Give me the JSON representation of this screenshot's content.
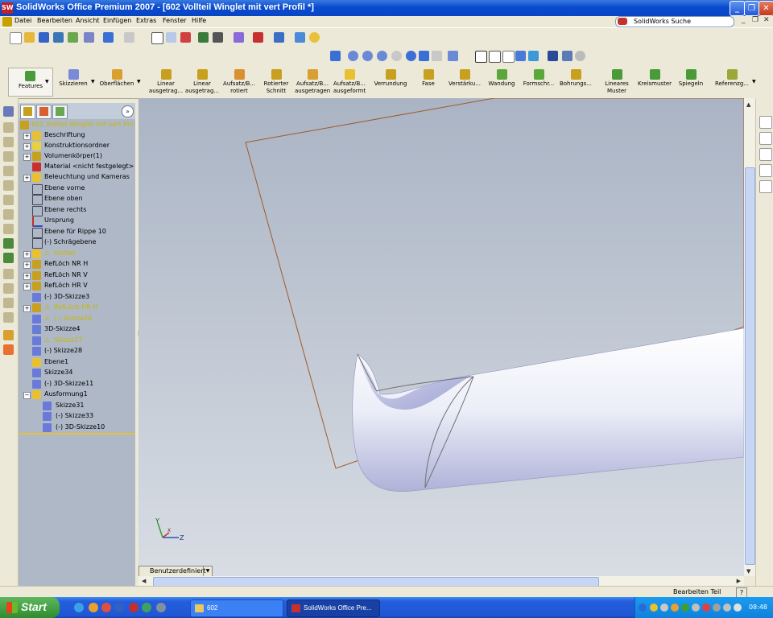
{
  "window": {
    "title": "SolidWorks Office Premium 2007 - [602 Vollteil Winglet mit vert Profil *]"
  },
  "menu": {
    "items": [
      "Datei",
      "Bearbeiten",
      "Ansicht",
      "Einfügen",
      "Extras",
      "Fenster",
      "Hilfe"
    ],
    "search_label": "SolidWorks Suche"
  },
  "command_manager": {
    "tabs": [
      "Features",
      "Skizzieren",
      "Oberflächen"
    ],
    "buttons": [
      {
        "line1": "Linear",
        "line2": "ausgetrag..."
      },
      {
        "line1": "Linear",
        "line2": "ausgetrag..."
      },
      {
        "line1": "Aufsatz/B...",
        "line2": "rotiert"
      },
      {
        "line1": "Rotierter",
        "line2": "Schnitt"
      },
      {
        "line1": "Aufsatz/B...",
        "line2": "ausgetragen"
      },
      {
        "line1": "Aufsatz/B...",
        "line2": "ausgeformt"
      },
      {
        "line1": "Verrundung",
        "line2": ""
      },
      {
        "line1": "Fase",
        "line2": ""
      },
      {
        "line1": "Verstärku...",
        "line2": ""
      },
      {
        "line1": "Wandung",
        "line2": ""
      },
      {
        "line1": "Formschr...",
        "line2": ""
      },
      {
        "line1": "Bohrungs...",
        "line2": ""
      },
      {
        "line1": "Lineares",
        "line2": "Muster"
      },
      {
        "line1": "Kreismuster",
        "line2": ""
      },
      {
        "line1": "Spiegeln",
        "line2": ""
      },
      {
        "line1": "Referenzg...",
        "line2": ""
      }
    ]
  },
  "feature_tree": {
    "root": "602 Vollteil Winglet mit vert Pro",
    "items": [
      {
        "label": "Beschriftung"
      },
      {
        "label": "Konstruktionsordner"
      },
      {
        "label": "Volumenkörper(1)"
      },
      {
        "label": "Material <nicht festgelegt>"
      },
      {
        "label": "Beleuchtung und Kameras"
      },
      {
        "label": "Ebene vorne"
      },
      {
        "label": "Ebene oben"
      },
      {
        "label": "Ebene rechts"
      },
      {
        "label": "Ursprung"
      },
      {
        "label": "Ebene für Rippe 10"
      },
      {
        "label": "(-) Schrägebene"
      },
      {
        "label": "Vollteil"
      },
      {
        "label": "RefLöch NR H"
      },
      {
        "label": "RefLöch NR V"
      },
      {
        "label": "RefLöch HR V"
      },
      {
        "label": "(-) 3D-Skizze3"
      },
      {
        "label": "RefLöch HR H"
      },
      {
        "label": "(-) Skizze26"
      },
      {
        "label": "3D-Skizze4"
      },
      {
        "label": "Skizze27"
      },
      {
        "label": "(-) Skizze28"
      },
      {
        "label": "Ebene1"
      },
      {
        "label": "Skizze34"
      },
      {
        "label": "(-) 3D-Skizze11"
      },
      {
        "label": "Ausformung1"
      },
      {
        "label": "Skizze31"
      },
      {
        "label": "(-) Skizze33"
      },
      {
        "label": "(-) 3D-Skizze10"
      }
    ]
  },
  "viewport": {
    "view_tab": "Benutzerdefiniert",
    "triad": {
      "x": "X",
      "y": "Y",
      "z": "Z"
    }
  },
  "status": {
    "text": "Bearbeiten Teil",
    "help": "?"
  },
  "taskbar": {
    "start": "Start",
    "tasks": [
      "602",
      "SolidWorks Office Pre..."
    ],
    "clock": "08:48"
  }
}
